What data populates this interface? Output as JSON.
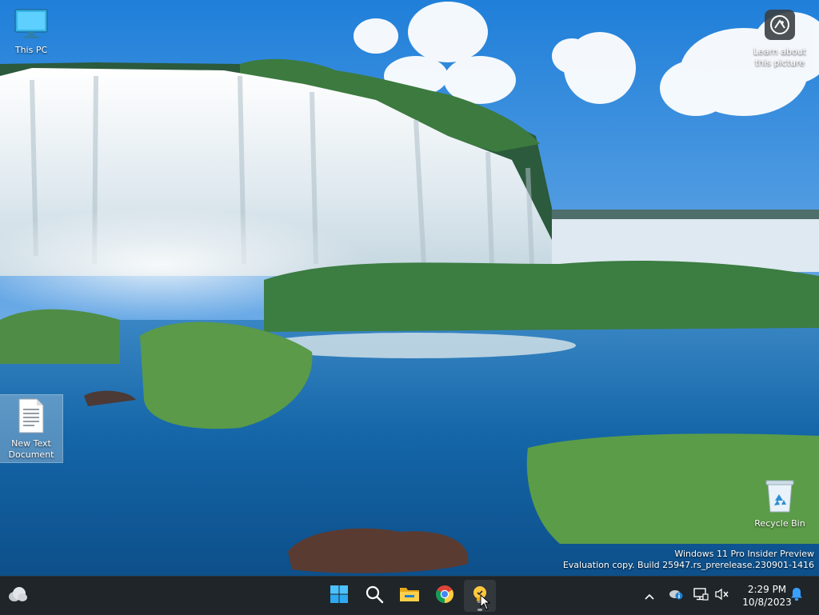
{
  "desktop": {
    "icons": [
      {
        "label": "This PC",
        "icon": "this-pc-icon"
      },
      {
        "label": "Learn about this picture",
        "icon": "learn-about-picture-icon"
      },
      {
        "label": "New Text Document",
        "icon": "text-document-icon"
      },
      {
        "label": "Recycle Bin",
        "icon": "recycle-bin-icon"
      }
    ],
    "watermark": {
      "line1": "Windows 11 Pro Insider Preview",
      "line2": "Evaluation copy. Build 25947.rs_prerelease.230901-1416"
    }
  },
  "taskbar": {
    "widgets_icon": "weather-cloud-icon",
    "pinned": [
      {
        "name": "Start",
        "icon": "windows-start-icon"
      },
      {
        "name": "Search",
        "icon": "search-icon"
      },
      {
        "name": "File Explorer",
        "icon": "file-explorer-icon"
      },
      {
        "name": "Google Chrome",
        "icon": "chrome-icon"
      },
      {
        "name": "Tips",
        "icon": "lightbulb-icon",
        "active": true
      }
    ],
    "tray": {
      "overflow_icon": "chevron-up-icon",
      "onedrive_icon": "onedrive-icon",
      "network_icon": "network-icon",
      "volume_icon": "volume-muted-icon",
      "notification_icon": "notification-bell-icon"
    },
    "clock": {
      "time": "2:29 PM",
      "date": "10/8/2023"
    }
  },
  "colors": {
    "taskbar_bg": "#1f2529",
    "accent": "#0078d4",
    "notification": "#3aa0ff"
  }
}
